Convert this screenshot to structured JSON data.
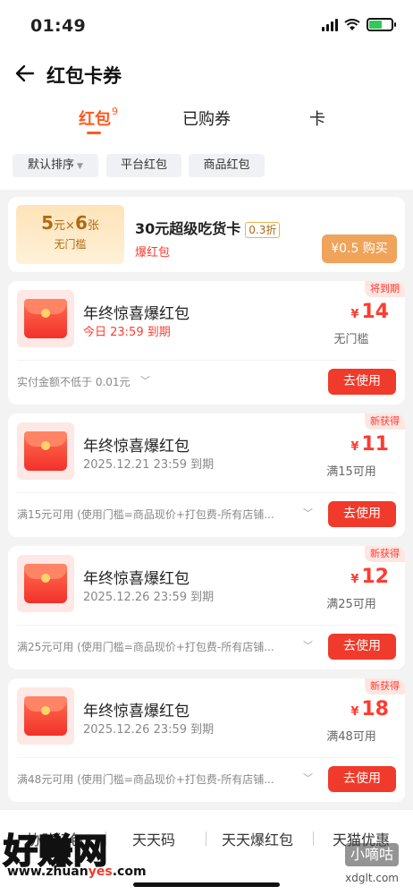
{
  "status": {
    "time": "01:49"
  },
  "header": {
    "title": "红包卡券"
  },
  "tabs": [
    {
      "label": "红包",
      "count": "9"
    },
    {
      "label": "已购券"
    },
    {
      "label": "卡"
    }
  ],
  "filters": {
    "sort": "默认排序",
    "platform": "平台红包",
    "product": "商品红包"
  },
  "promo": {
    "amount": "5",
    "amount_unit": "元",
    "times": "×",
    "count": "6",
    "count_unit": "张",
    "threshold": "无门槛",
    "title": "30元超级吃货卡",
    "discount": "0.3折",
    "tag": "爆红包",
    "buy": "¥0.5 购买"
  },
  "coupons": [
    {
      "name": "年终惊喜爆红包",
      "expire": "今日 23:59 到期",
      "badge": "将到期",
      "currency": "¥",
      "amount": "14",
      "condition": "无门槛",
      "note": "实付金额不低于 0.01元",
      "use": "去使用"
    },
    {
      "name": "年终惊喜爆红包",
      "expire": "2025.12.21 23:59 到期",
      "badge": "新获得",
      "currency": "¥",
      "amount": "11",
      "condition": "满15可用",
      "note": "满15元可用 (使用门槛=商品现价+打包费-所有店铺...",
      "use": "去使用"
    },
    {
      "name": "年终惊喜爆红包",
      "expire": "2025.12.26 23:59 到期",
      "badge": "新获得",
      "currency": "¥",
      "amount": "12",
      "condition": "满25可用",
      "note": "满25元可用 (使用门槛=商品现价+打包费-所有店铺...",
      "use": "去使用"
    },
    {
      "name": "年终惊喜爆红包",
      "expire": "2025.12.26 23:59 到期",
      "badge": "新获得",
      "currency": "¥",
      "amount": "18",
      "condition": "满48可用",
      "note": "满48元可用 (使用门槛=商品现价+打包费-所有店铺...",
      "use": "去使用"
    }
  ],
  "bottom_tabs": [
    "协助红包",
    "天天码",
    "天天爆红包",
    "天猫优惠"
  ],
  "watermark": {
    "brand": "好赚网",
    "url_a": "www.zhuan",
    "url_b": "yes",
    "url_c": ".com",
    "right": "小嘀咕",
    "right_url": "xdglt.com"
  }
}
